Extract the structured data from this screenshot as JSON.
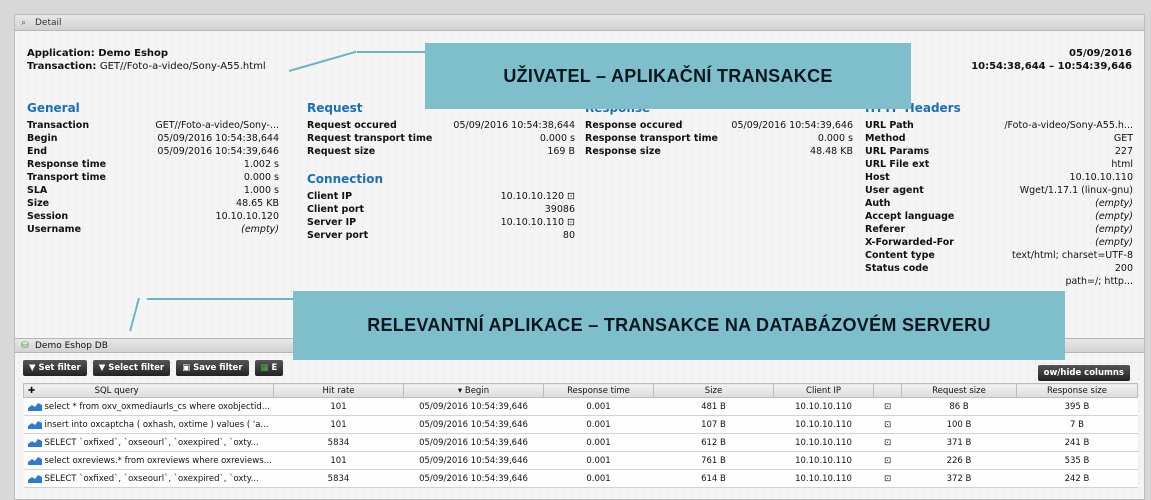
{
  "window": {
    "title": "Detail"
  },
  "header": {
    "application_label": "Application:",
    "application_value": "Demo Eshop",
    "transaction_label": "Transaction:",
    "transaction_value": "GET//Foto-a-video/Sony-A55.html",
    "date": "05/09/2016",
    "time_range": "10:54:38,644 – 10:54:39,646"
  },
  "general": {
    "title": "General",
    "rows": [
      {
        "k": "Transaction",
        "v": "GET//Foto-a-video/Sony-..."
      },
      {
        "k": "Begin",
        "v": "05/09/2016 10:54:38,644"
      },
      {
        "k": "End",
        "v": "05/09/2016 10:54:39,646"
      },
      {
        "k": "Response time",
        "v": "1.002 s"
      },
      {
        "k": "Transport time",
        "v": "0.000 s"
      },
      {
        "k": "SLA",
        "v": "1.000 s"
      },
      {
        "k": "Size",
        "v": "48.65 KB"
      },
      {
        "k": "Session",
        "v": "10.10.10.120"
      },
      {
        "k": "Username",
        "v": "(empty)"
      }
    ]
  },
  "request": {
    "title": "Request",
    "rows": [
      {
        "k": "Request occured",
        "v": "05/09/2016 10:54:38,644"
      },
      {
        "k": "Request transport time",
        "v": "0.000 s"
      },
      {
        "k": "Request size",
        "v": "169 B"
      }
    ]
  },
  "connection": {
    "title": "Connection",
    "rows": [
      {
        "k": "Client IP",
        "v": "10.10.10.120 ⊡"
      },
      {
        "k": "Client port",
        "v": "39086"
      },
      {
        "k": "Server IP",
        "v": "10.10.10.110 ⊡"
      },
      {
        "k": "Server port",
        "v": "80"
      }
    ]
  },
  "response": {
    "title": "Response",
    "rows": [
      {
        "k": "Response occured",
        "v": "05/09/2016 10:54:39,646"
      },
      {
        "k": "Response transport time",
        "v": "0.000 s"
      },
      {
        "k": "Response size",
        "v": "48.48 KB"
      }
    ]
  },
  "http": {
    "title": "HTTP Headers",
    "rows": [
      {
        "k": "URL Path",
        "v": "/Foto-a-video/Sony-A55.h..."
      },
      {
        "k": "Method",
        "v": "GET"
      },
      {
        "k": "URL Params",
        "v": "227"
      },
      {
        "k": "URL File ext",
        "v": "html"
      },
      {
        "k": "Host",
        "v": "10.10.10.110"
      },
      {
        "k": "User agent",
        "v": "Wget/1.17.1 (linux-gnu)"
      },
      {
        "k": "Auth",
        "v": "(empty)"
      },
      {
        "k": "Accept language",
        "v": "(empty)"
      },
      {
        "k": "Referer",
        "v": "(empty)"
      },
      {
        "k": "X-Forwarded-For",
        "v": "(empty)"
      },
      {
        "k": "Content type",
        "v": "text/html; charset=UTF-8"
      },
      {
        "k": "Status code",
        "v": "200"
      },
      {
        "k": "",
        "v": "path=/; http..."
      }
    ]
  },
  "callouts": {
    "top": "UŽIVATEL – APLIKAČNÍ TRANSAKCE",
    "bottom": "RELEVANTNÍ APLIKACE – TRANSAKCE NA DATABÁZOVÉM SERVERU"
  },
  "db_panel": {
    "title": "Demo Eshop DB"
  },
  "toolbar": {
    "set_filter": "Set filter",
    "select_filter": "Select filter",
    "save_filter": "Save filter",
    "export": "E",
    "show_hide": "ow/hide columns"
  },
  "table": {
    "headers": [
      "SQL query",
      "Hit rate",
      "Begin",
      "Response time",
      "Size",
      "Client IP",
      "",
      "Request size",
      "Response size"
    ],
    "rows": [
      [
        "select * from oxv_oxmediaurls_cs where oxobjectid...",
        "101",
        "05/09/2016 10:54:39,646",
        "0.001",
        "481 B",
        "10.10.10.110",
        "⊡",
        "86 B",
        "395 B"
      ],
      [
        "insert into oxcaptcha ( oxhash, oxtime ) values ( 'a...",
        "101",
        "05/09/2016 10:54:39,646",
        "0.001",
        "107 B",
        "10.10.10.110",
        "⊡",
        "100 B",
        "7 B"
      ],
      [
        "SELECT `oxfixed`, `oxseourl`, `oxexpired`, `oxty...",
        "5834",
        "05/09/2016 10:54:39,646",
        "0.001",
        "612 B",
        "10.10.10.110",
        "⊡",
        "371 B",
        "241 B"
      ],
      [
        "select oxreviews.* from oxreviews where oxreviews...",
        "101",
        "05/09/2016 10:54:39,646",
        "0.001",
        "761 B",
        "10.10.10.110",
        "⊡",
        "226 B",
        "535 B"
      ],
      [
        "SELECT `oxfixed`, `oxseourl`, `oxexpired`, `oxty...",
        "5834",
        "05/09/2016 10:54:39,646",
        "0.001",
        "614 B",
        "10.10.10.110",
        "⊡",
        "372 B",
        "242 B"
      ]
    ]
  },
  "colors": {
    "section_blue": "#1b6fb8",
    "callout": "#7fbfcc"
  }
}
